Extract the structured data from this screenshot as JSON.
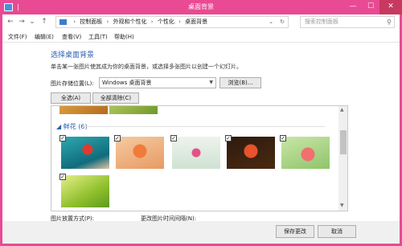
{
  "window": {
    "title": "桌面背景",
    "minimize_glyph": "—",
    "maximize_glyph": "☐",
    "close_glyph": "✕"
  },
  "address": {
    "nav_back": "←",
    "nav_forward": "→",
    "nav_recent": "⌄",
    "nav_up": "↑",
    "breadcrumbs": [
      "控制面板",
      "外观和个性化",
      "个性化",
      "桌面背景"
    ],
    "separator": "›",
    "dropdown_glyph": "⌄",
    "refresh_glyph": "↻",
    "search_placeholder": "搜索控制面板",
    "search_glyph": "⚲"
  },
  "menu": {
    "items": [
      "文件(F)",
      "编辑(E)",
      "查看(V)",
      "工具(T)",
      "帮助(H)"
    ]
  },
  "content": {
    "heading": "选择桌面背景",
    "description": "单击某一张图片使其成为你的桌面背景，或选择多张图片以创建一个幻灯片。",
    "location_label": "图片存储位置(L):",
    "location_value": "Windows 桌面背景",
    "select_arrow": "▼",
    "browse_label": "浏览(B)...",
    "select_all_label": "全选(A)",
    "clear_all_label": "全部清除(C)",
    "group_label": "◢ 鲜花 (6)",
    "check_glyph": "✓",
    "scroll_up": "▲",
    "scroll_down": "▼",
    "position_label": "图片放置方式(P):",
    "interval_label": "更改图片时间间隔(N):"
  },
  "footer": {
    "save_label": "保存更改",
    "cancel_label": "取消"
  },
  "colors": {
    "title_bar": "#e84a93",
    "heading": "#2b5fb3"
  }
}
